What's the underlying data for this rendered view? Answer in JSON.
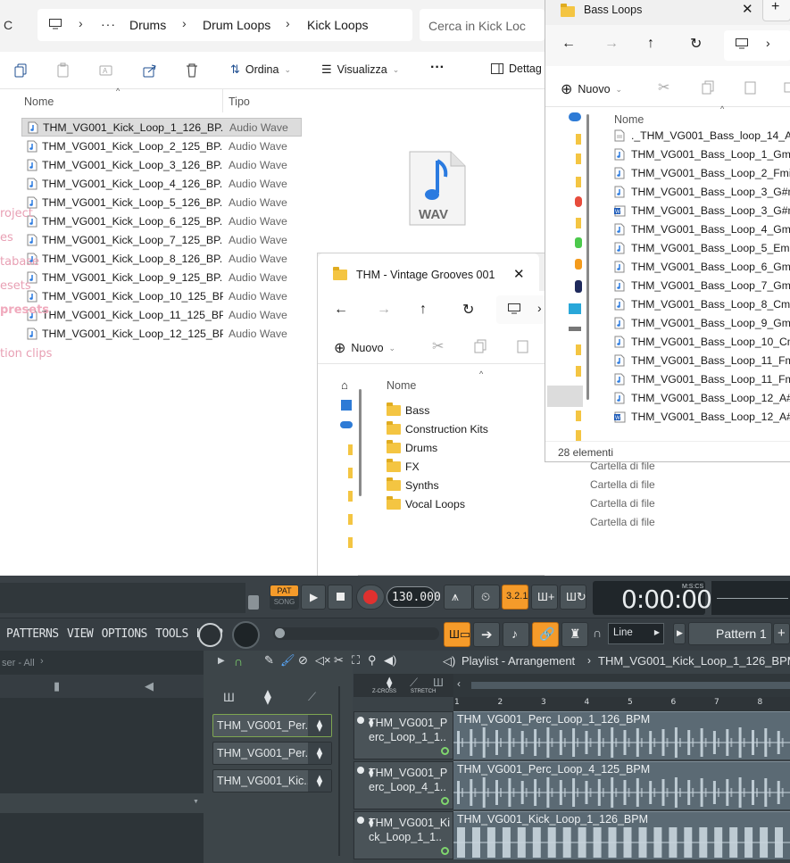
{
  "explorer_main": {
    "breadcrumb": [
      "Drums",
      "Drum Loops",
      "Kick Loops"
    ],
    "search_placeholder": "Cerca in Kick Loc",
    "commands": {
      "sort": "Ordina",
      "view": "Visualizza",
      "more": "···",
      "details": "Dettag"
    },
    "columns": {
      "name": "Nome",
      "type": "Tipo"
    },
    "files": [
      {
        "name": "THM_VG001_Kick_Loop_1_126_BP...",
        "type": "Audio Wave"
      },
      {
        "name": "THM_VG001_Kick_Loop_2_125_BP...",
        "type": "Audio Wave"
      },
      {
        "name": "THM_VG001_Kick_Loop_3_126_BP...",
        "type": "Audio Wave"
      },
      {
        "name": "THM_VG001_Kick_Loop_4_126_BP...",
        "type": "Audio Wave"
      },
      {
        "name": "THM_VG001_Kick_Loop_5_126_BP...",
        "type": "Audio Wave"
      },
      {
        "name": "THM_VG001_Kick_Loop_6_125_BP...",
        "type": "Audio Wave"
      },
      {
        "name": "THM_VG001_Kick_Loop_7_125_BP...",
        "type": "Audio Wave"
      },
      {
        "name": "THM_VG001_Kick_Loop_8_126_BP...",
        "type": "Audio Wave"
      },
      {
        "name": "THM_VG001_Kick_Loop_9_125_BP...",
        "type": "Audio Wave"
      },
      {
        "name": "THM_VG001_Kick_Loop_10_125_BP...",
        "type": "Audio Wave"
      },
      {
        "name": "THM_VG001_Kick_Loop_11_125_BP...",
        "type": "Audio Wave"
      },
      {
        "name": "THM_VG001_Kick_Loop_12_125_BP...",
        "type": "Audio Wave"
      }
    ],
    "preview_label": "WAV"
  },
  "explorer_vintage": {
    "title": "THM - Vintage Grooves 001",
    "new_label": "Nuovo",
    "column_name": "Nome",
    "folders": [
      "Bass",
      "Construction Kits",
      "Drums",
      "FX",
      "Synths",
      "Vocal Loops"
    ],
    "folder_type": "Cartella di file"
  },
  "explorer_bass": {
    "title": "Bass Loops",
    "new_label": "Nuovo",
    "column_name": "Nome",
    "files": [
      "._THM_VG001_Bass_loop_14_A#m",
      "THM_VG001_Bass_Loop_1_Gmin_1",
      "THM_VG001_Bass_Loop_2_Fmin_1",
      "THM_VG001_Bass_Loop_3_G#min",
      "THM_VG001_Bass_Loop_3_G#min",
      "THM_VG001_Bass_Loop_4_Gmin_1",
      "THM_VG001_Bass_Loop_5_Emin_1",
      "THM_VG001_Bass_Loop_6_Gmin_1",
      "THM_VG001_Bass_Loop_7_Gmin_1",
      "THM_VG001_Bass_Loop_8_Cmin_1",
      "THM_VG001_Bass_Loop_9_Gmin_1",
      "THM_VG001_Bass_Loop_10_Cmin_",
      "THM_VG001_Bass_Loop_11_Fmin_",
      "THM_VG001_Bass_Loop_11_Fmin_",
      "THM_VG001_Bass_Loop_12_A#mi",
      "THM_VG001_Bass_Loop_12_A#mi"
    ],
    "status": "28 elementi"
  },
  "fl_studio": {
    "pat_label": "PAT",
    "song_label": "SONG",
    "tempo": "130.000",
    "time": "0:00:00",
    "time_unit": "M:S:CS",
    "menu": "PATTERNS VIEW OPTIONS TOOLS HELP",
    "snap": "Line",
    "pattern": "Pattern 1",
    "browser_header": "ser - All",
    "browser_items": [
      "roject",
      "es",
      "tabase",
      "esets",
      "presets",
      "tion clips"
    ],
    "channels": [
      "THM_VG001_Per...",
      "THM_VG001_Per...",
      "THM_VG001_Kic..."
    ],
    "playlist_title": "Playlist - Arrangement",
    "playlist_pattern": "THM_VG001_Kick_Loop_1_126_BPM",
    "zcross": "Z-CROSS",
    "stretch": "STRETCH",
    "ruler": [
      "1",
      "2",
      "3",
      "4",
      "5",
      "6",
      "7",
      "8"
    ],
    "tracks": [
      {
        "name": "THM_VG001_Perc_Loop_1_1..",
        "clip": "THM_VG001_Perc_Loop_1_126_BPM"
      },
      {
        "name": "THM_VG001_Perc_Loop_4_1..",
        "clip": "THM_VG001_Perc_Loop_4_125_BPM"
      },
      {
        "name": "THM_VG001_Kick_Loop_1_1..",
        "clip": "THM_VG001_Kick_Loop_1_126_BPM"
      }
    ]
  }
}
